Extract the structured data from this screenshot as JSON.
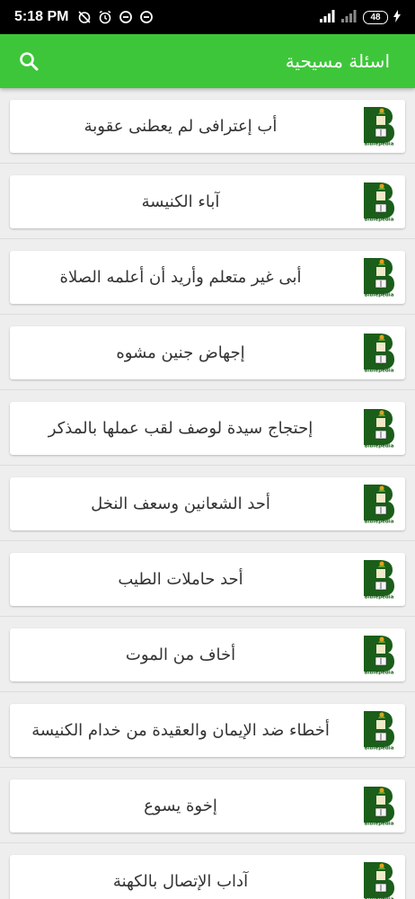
{
  "status_bar": {
    "time": "5:18 PM",
    "battery": "48"
  },
  "app_bar": {
    "title": "اسئلة مسيحية",
    "search_icon": "search-icon"
  },
  "logo": {
    "icon": "biblepedia-logo",
    "letter": "B",
    "caption": "Biblepedia",
    "brand_color": "#1a5e1a"
  },
  "items": [
    "أب إعترافى لم يعطنى عقوبة",
    "آباء الكنيسة",
    "أبى غير متعلم وأريد أن أعلمه الصلاة",
    "إجهاض جنين مشوه",
    "إحتجاج سيدة لوصف لقب عملها بالمذكر",
    "أحد الشعانين وسعف النخل",
    "أحد حاملات الطيب",
    "أخاف من الموت",
    "أخطاء ضد الإيمان والعقيدة من خدام الكنيسة",
    "إخوة يسوع",
    "آداب الإتصال بالكهنة"
  ],
  "colors": {
    "app_bar": "#3ec63a",
    "status_bar": "#000000",
    "background": "#eeeeee"
  }
}
